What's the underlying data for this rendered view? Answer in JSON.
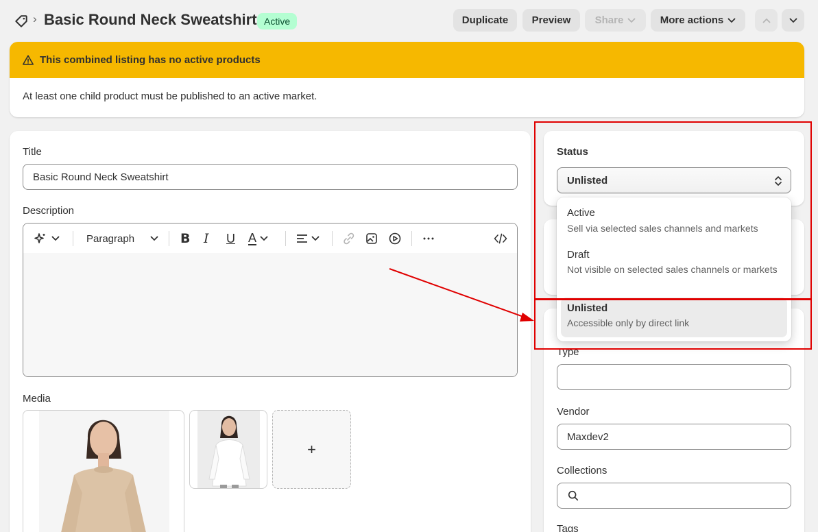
{
  "header": {
    "title": "Basic Round Neck Sweatshirt",
    "status_badge": "Active",
    "buttons": {
      "duplicate": "Duplicate",
      "preview": "Preview",
      "share": "Share",
      "more_actions": "More actions"
    }
  },
  "banner": {
    "title": "This combined listing has no active products",
    "body": "At least one child product must be published to an active market."
  },
  "product": {
    "title_label": "Title",
    "title_value": "Basic Round Neck Sweatshirt",
    "description_label": "Description",
    "toolbar": {
      "paragraph": "Paragraph"
    },
    "media_label": "Media",
    "add_media": "+"
  },
  "status": {
    "label": "Status",
    "selected": "Unlisted",
    "options": [
      {
        "label": "Active",
        "description": "Sell via selected sales channels and markets"
      },
      {
        "label": "Draft",
        "description": "Not visible on selected sales channels or markets"
      },
      {
        "label": "Unlisted",
        "description": "Accessible only by direct link"
      }
    ]
  },
  "organization": {
    "type_label": "Type",
    "type_value": "",
    "vendor_label": "Vendor",
    "vendor_value": "Maxdev2",
    "collections_label": "Collections",
    "collections_value": "",
    "tags_label": "Tags"
  },
  "colors": {
    "banner": "#f6b800",
    "badge_bg": "#b4fed2",
    "badge_text": "#0c5132",
    "annotation": "#e00000"
  }
}
